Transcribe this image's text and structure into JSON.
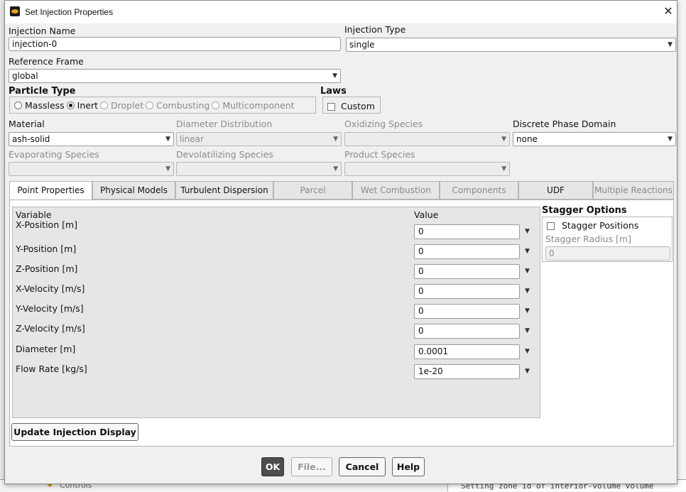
{
  "dialog": {
    "title": "Set Injection Properties",
    "close": "✕"
  },
  "injection_name": {
    "label": "Injection Name",
    "value": "injection-0"
  },
  "injection_type": {
    "label": "Injection Type",
    "value": "single"
  },
  "reference_frame": {
    "label": "Reference Frame",
    "value": "global"
  },
  "particle_type": {
    "label": "Particle Type",
    "options": [
      "Massless",
      "Inert",
      "Droplet",
      "Combusting",
      "Multicomponent"
    ],
    "selected": "Inert"
  },
  "laws": {
    "label": "Laws",
    "custom_label": "Custom"
  },
  "material": {
    "label": "Material",
    "value": "ash-solid"
  },
  "diameter_distribution": {
    "label": "Diameter Distribution",
    "value": "linear"
  },
  "oxidizing_species": {
    "label": "Oxidizing Species",
    "value": ""
  },
  "discrete_phase_domain": {
    "label": "Discrete Phase Domain",
    "value": "none"
  },
  "evaporating_species": {
    "label": "Evaporating Species",
    "value": ""
  },
  "devolatilizing_species": {
    "label": "Devolatilizing Species",
    "value": ""
  },
  "product_species": {
    "label": "Product Species",
    "value": ""
  },
  "tabs": [
    "Point Properties",
    "Physical Models",
    "Turbulent Dispersion",
    "Parcel",
    "Wet Combustion",
    "Components",
    "UDF",
    "Multiple Reactions"
  ],
  "active_tab": "Point Properties",
  "point_properties": {
    "variable_header": "Variable",
    "value_header": "Value",
    "rows": [
      {
        "label": "X-Position [m]",
        "value": "0"
      },
      {
        "label": "Y-Position [m]",
        "value": "0"
      },
      {
        "label": "Z-Position [m]",
        "value": "0"
      },
      {
        "label": "X-Velocity [m/s]",
        "value": "0"
      },
      {
        "label": "Y-Velocity [m/s]",
        "value": "0"
      },
      {
        "label": "Z-Velocity [m/s]",
        "value": "0"
      },
      {
        "label": "Diameter [m]",
        "value": "0.0001"
      },
      {
        "label": "Flow Rate [kg/s]",
        "value": "1e-20"
      }
    ]
  },
  "stagger": {
    "title": "Stagger Options",
    "positions_label": "Stagger Positions",
    "radius_label": "Stagger Radius [m]",
    "radius_value": "0"
  },
  "buttons": {
    "update": "Update Injection Display",
    "ok": "OK",
    "file": "File...",
    "cancel": "Cancel",
    "help": "Help"
  },
  "background": {
    "controls_label": "Controls",
    "console_text": "Setting zone id of interior-volume volume"
  }
}
